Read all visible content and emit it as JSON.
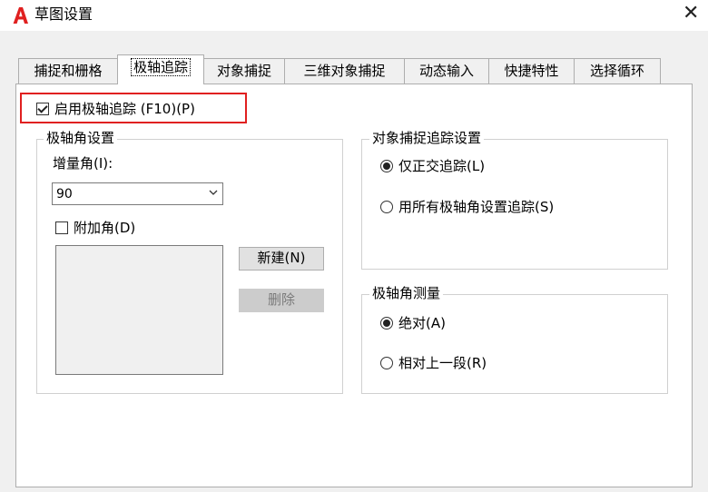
{
  "window": {
    "title": "草图设置",
    "close_glyph": "✕",
    "accent": "#e02020"
  },
  "tabs": [
    {
      "label": "捕捉和栅格",
      "active": false
    },
    {
      "label": "极轴追踪",
      "active": true
    },
    {
      "label": "对象捕捉",
      "active": false
    },
    {
      "label": "三维对象捕捉",
      "active": false
    },
    {
      "label": "动态输入",
      "active": false
    },
    {
      "label": "快捷特性",
      "active": false
    },
    {
      "label": "选择循环",
      "active": false
    }
  ],
  "enable_polar": {
    "label": "启用极轴追踪 (F10)(P)",
    "checked": true
  },
  "polar_angle": {
    "group_label": "极轴角设置",
    "increment_label": "增量角(I):",
    "increment_value": "90",
    "additional_label": "附加角(D)",
    "additional_checked": false,
    "new_button": "新建(N)",
    "delete_button": "删除"
  },
  "object_snap_tracking": {
    "group_label": "对象捕捉追踪设置",
    "options": [
      {
        "label": "仅正交追踪(L)",
        "selected": true
      },
      {
        "label": "用所有极轴角设置追踪(S)",
        "selected": false
      }
    ]
  },
  "polar_measure": {
    "group_label": "极轴角测量",
    "options": [
      {
        "label": "绝对(A)",
        "selected": true
      },
      {
        "label": "相对上一段(R)",
        "selected": false
      }
    ]
  }
}
